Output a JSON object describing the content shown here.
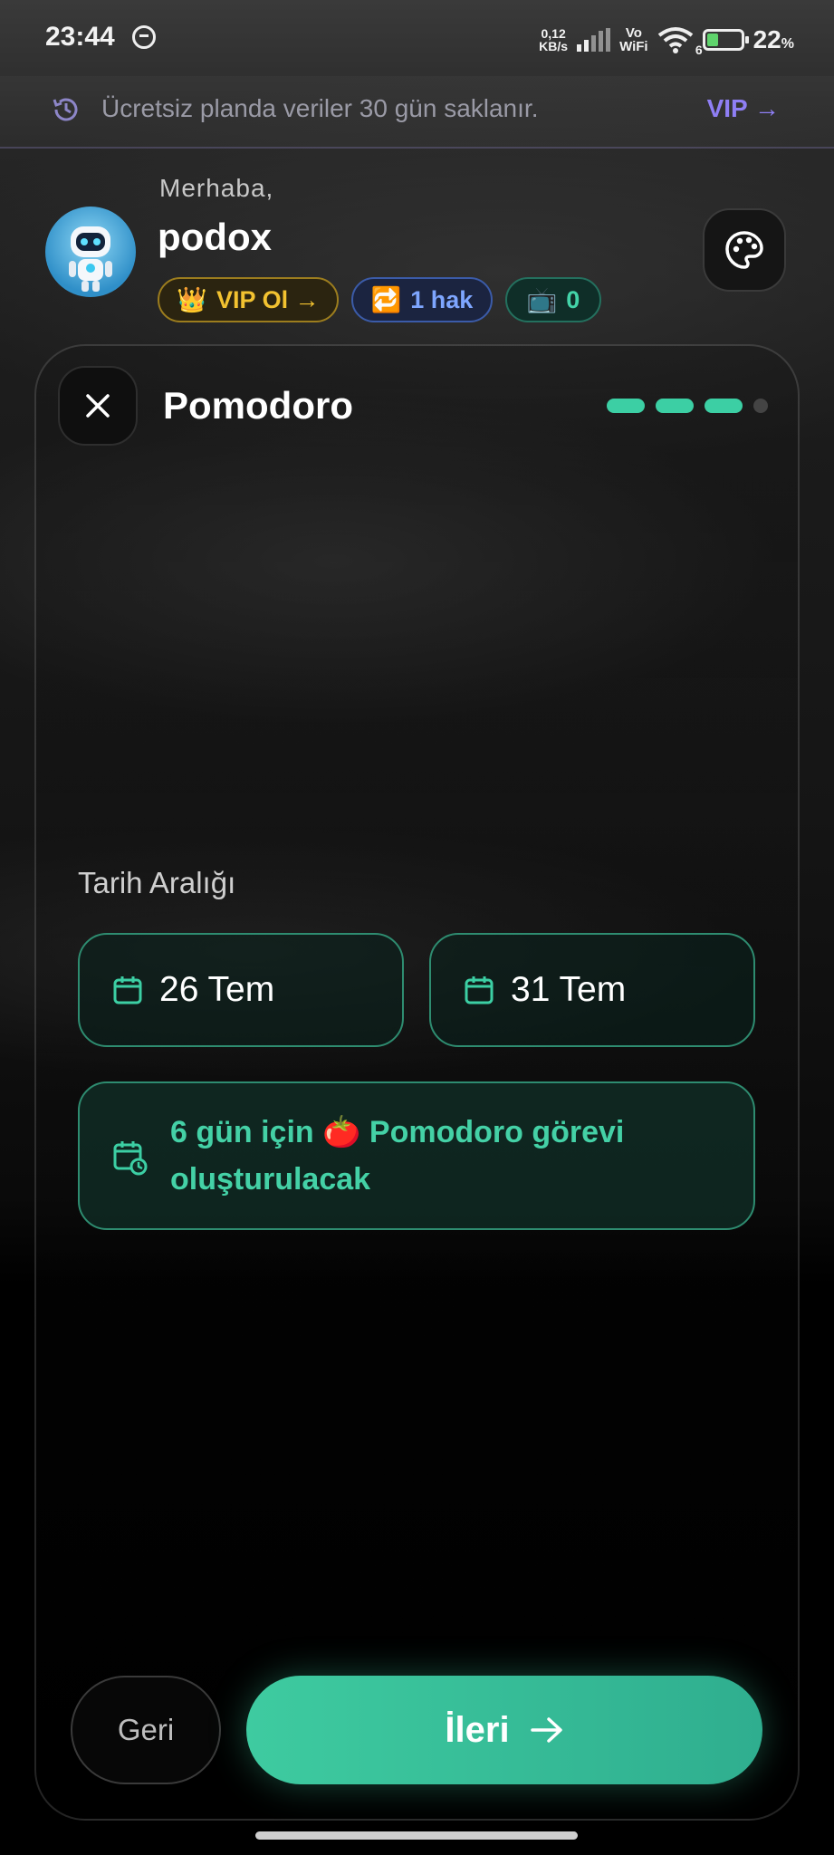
{
  "status": {
    "time": "23:44",
    "net_speed_value": "0,12",
    "net_speed_unit": "KB/s",
    "vo": "Vo",
    "wifi_label": "WiFi",
    "wifi_num": "6",
    "battery_pct": "22",
    "battery_unit": "%"
  },
  "banner": {
    "text": "Ücretsiz planda veriler 30 gün saklanır.",
    "vip_link": "VIP →"
  },
  "header": {
    "greeting": "Merhaba,",
    "username": "podox",
    "chips": {
      "vip": "VIP Ol →",
      "vip_emoji": "👑",
      "hak": "1 hak",
      "hak_emoji": "🔁",
      "tv": "0",
      "tv_emoji": "📺"
    }
  },
  "card": {
    "title": "Pomodoro",
    "steps_total": 4,
    "steps_done": 3,
    "range_label": "Tarih Aralığı",
    "start_date": "26 Tem",
    "end_date": "31 Tem",
    "info": "6 gün için 🍅 Pomodoro görevi oluşturulacak",
    "back_label": "Geri",
    "next_label": "İleri"
  },
  "colors": {
    "accent": "#3ccfa4",
    "vip_purple": "#8f7ff5",
    "gold": "#f2c230"
  }
}
